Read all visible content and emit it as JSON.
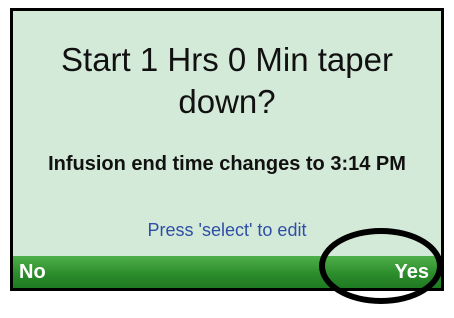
{
  "dialog": {
    "title": "Start 1 Hrs 0 Min taper down?",
    "info": "Infusion end time changes to 3:14 PM",
    "hint": "Press 'select' to edit"
  },
  "softkeys": {
    "left_label": "No",
    "right_label": "Yes"
  },
  "colors": {
    "screen_background": "#d4ead8",
    "softkey_bar": "#2c8d2c",
    "hint_text": "#2e4ea6"
  }
}
